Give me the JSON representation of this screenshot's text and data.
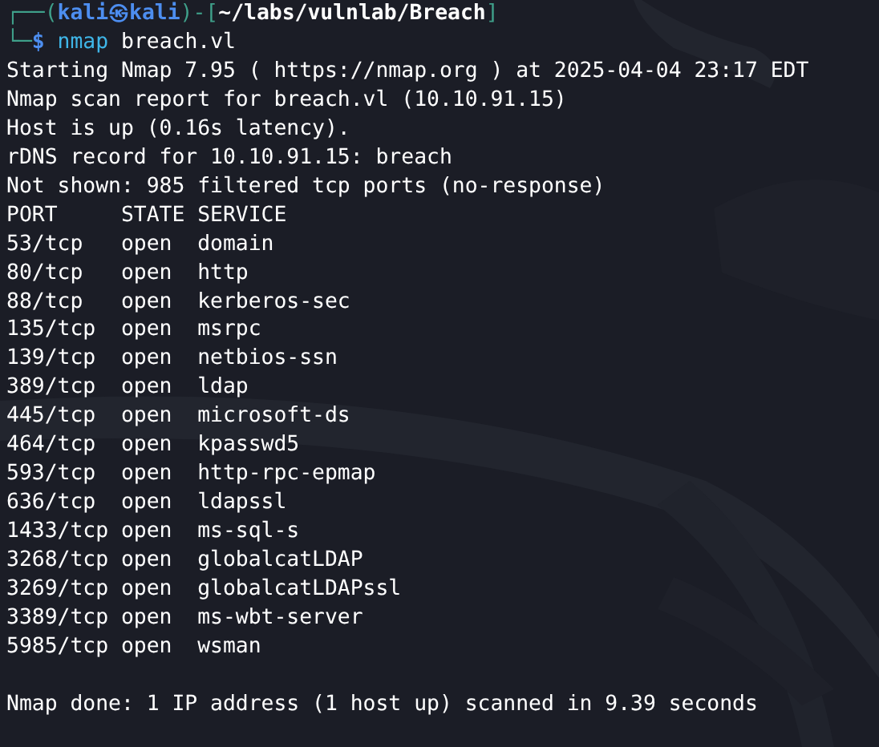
{
  "prompt": {
    "corner_top": "┌──(",
    "identity": "kali㉿kali",
    "mid": ")-[",
    "cwd": "~/labs/vulnlab/Breach",
    "close": "]",
    "corner_bottom": "└─",
    "symbol": "$",
    "command": "nmap",
    "argument": "breach.vl"
  },
  "output_lines": [
    "Starting Nmap 7.95 ( https://nmap.org ) at 2025-04-04 23:17 EDT",
    "Nmap scan report for breach.vl (10.10.91.15)",
    "Host is up (0.16s latency).",
    "rDNS record for 10.10.91.15: breach",
    "Not shown: 985 filtered tcp ports (no-response)"
  ],
  "table": {
    "columns": [
      "PORT",
      "STATE",
      "SERVICE"
    ],
    "rows": [
      {
        "port": "53/tcp",
        "state": "open",
        "service": "domain"
      },
      {
        "port": "80/tcp",
        "state": "open",
        "service": "http"
      },
      {
        "port": "88/tcp",
        "state": "open",
        "service": "kerberos-sec"
      },
      {
        "port": "135/tcp",
        "state": "open",
        "service": "msrpc"
      },
      {
        "port": "139/tcp",
        "state": "open",
        "service": "netbios-ssn"
      },
      {
        "port": "389/tcp",
        "state": "open",
        "service": "ldap"
      },
      {
        "port": "445/tcp",
        "state": "open",
        "service": "microsoft-ds"
      },
      {
        "port": "464/tcp",
        "state": "open",
        "service": "kpasswd5"
      },
      {
        "port": "593/tcp",
        "state": "open",
        "service": "http-rpc-epmap"
      },
      {
        "port": "636/tcp",
        "state": "open",
        "service": "ldapssl"
      },
      {
        "port": "1433/tcp",
        "state": "open",
        "service": "ms-sql-s"
      },
      {
        "port": "3268/tcp",
        "state": "open",
        "service": "globalcatLDAP"
      },
      {
        "port": "3269/tcp",
        "state": "open",
        "service": "globalcatLDAPssl"
      },
      {
        "port": "3389/tcp",
        "state": "open",
        "service": "ms-wbt-server"
      },
      {
        "port": "5985/tcp",
        "state": "open",
        "service": "wsman"
      }
    ]
  },
  "summary": "Nmap done: 1 IP address (1 host up) scanned in 9.39 seconds"
}
